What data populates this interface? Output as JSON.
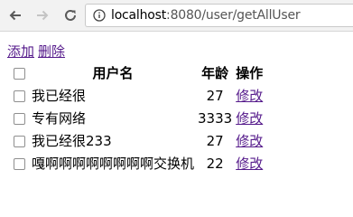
{
  "browser": {
    "url_host": "localhost",
    "url_path": ":8080/user/getAllUser"
  },
  "actions": {
    "add_label": "添加",
    "delete_label": "删除"
  },
  "table": {
    "headers": {
      "name": "用户名",
      "age": "年龄",
      "op": "操作"
    },
    "rows": [
      {
        "name": "我已经很",
        "age": "27",
        "op": "修改"
      },
      {
        "name": "专有网络",
        "age": "3333",
        "op": "修改"
      },
      {
        "name": "我已经很233",
        "age": "27",
        "op": "修改"
      },
      {
        "name": "嘎啊啊啊啊啊啊啊啊交换机",
        "age": "22",
        "op": "修改"
      }
    ]
  }
}
